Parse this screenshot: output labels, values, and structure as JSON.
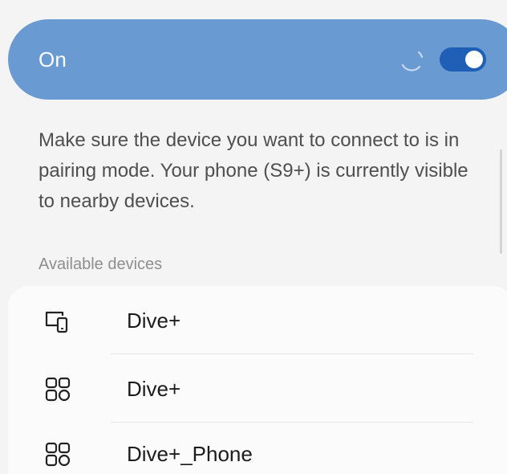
{
  "master": {
    "label": "On",
    "toggle_state": "on",
    "accent_color": "#6a9ad2",
    "toggle_color": "#1f5fb6"
  },
  "description": "Make sure the device you want to connect to is in pairing mode. Your phone (S9+) is currently visible to nearby devices.",
  "available_devices": {
    "header": "Available devices",
    "items": [
      {
        "name": "Dive+",
        "icon": "phone-tablet-icon"
      },
      {
        "name": "Dive+",
        "icon": "device-grid-icon"
      },
      {
        "name": "Dive+_Phone",
        "icon": "device-grid-icon"
      }
    ]
  }
}
